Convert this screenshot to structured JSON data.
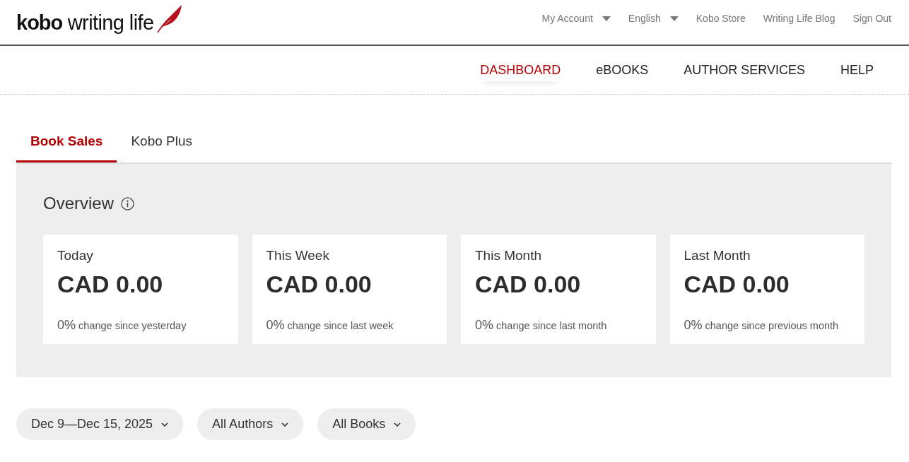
{
  "header": {
    "logo": "**kobo** writing life",
    "links": [
      {
        "label": "My Account",
        "kind": "dropdown"
      },
      {
        "label": "English",
        "kind": "dropdown"
      },
      {
        "label": "Kobo Store",
        "kind": "link"
      },
      {
        "label": "Writing Life Blog",
        "kind": "link"
      },
      {
        "label": "Sign Out",
        "kind": "link"
      }
    ]
  },
  "nav": [
    {
      "label": "DASHBOARD",
      "selected": true
    },
    {
      "label": "eBOOKS",
      "selected": false
    },
    {
      "label": "AUTHOR SERVICES",
      "selected": false
    },
    {
      "label": "HELP",
      "selected": false
    }
  ],
  "tabs": [
    {
      "label": "Book Sales",
      "selected": true
    },
    {
      "label": "Kobo Plus",
      "selected": false
    }
  ],
  "overview": {
    "title": "Overview",
    "cards": [
      {
        "period": "Today",
        "amount": "CAD 0.00",
        "change": "0%",
        "change_label": "change since yesterday"
      },
      {
        "period": "This Week",
        "amount": "CAD 0.00",
        "change": "0%",
        "change_label": "change since last week"
      },
      {
        "period": "This Month",
        "amount": "CAD 0.00",
        "change": "0%",
        "change_label": "change since last month"
      },
      {
        "period": "Last Month",
        "amount": "CAD 0.00",
        "change": "0%",
        "change_label": "change since previous month"
      }
    ]
  },
  "filters": [
    {
      "label": "Dec 9—Dec 15, 2025"
    },
    {
      "label": "All Authors"
    },
    {
      "label": "All Books"
    }
  ]
}
